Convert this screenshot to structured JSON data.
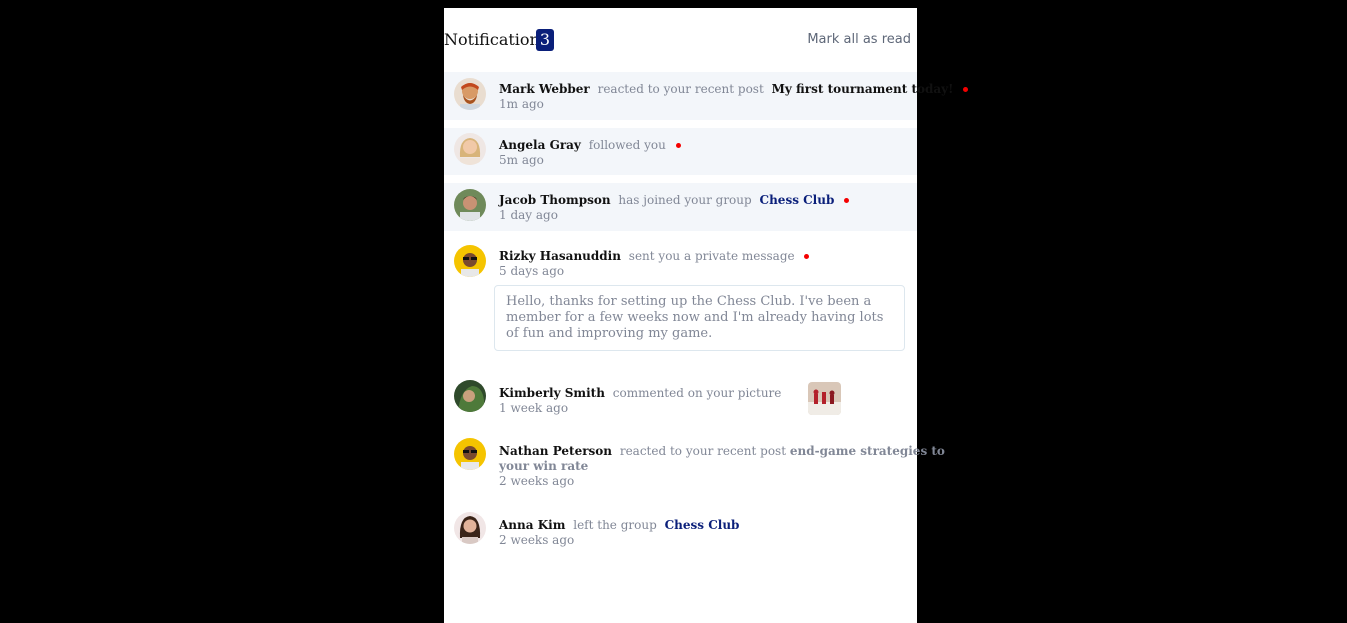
{
  "header": {
    "title": "Notifications",
    "badge_count": "3",
    "mark_all_label": "Mark all as read"
  },
  "notifications": [
    {
      "name": "Mark Webber",
      "action": "reacted to your recent post",
      "target": "My first tournament today!",
      "time": "1m ago",
      "unread": true
    },
    {
      "name": "Angela Gray",
      "action": "followed you",
      "time": "5m ago",
      "unread": true
    },
    {
      "name": "Jacob Thompson",
      "action": "has joined your group",
      "target": "Chess Club",
      "time": "1 day ago",
      "unread": true
    },
    {
      "name": "Rizky Hasanuddin",
      "action": "sent you a private message",
      "time": "5 days ago",
      "unread": true,
      "message": "Hello, thanks for setting up the Chess Club. I've been a member for a few weeks now and I'm already having lots of fun and improving my game."
    },
    {
      "name": "Kimberly Smith",
      "action": "commented on your picture",
      "time": "1 week ago",
      "unread": false
    },
    {
      "name": "Nathan Peterson",
      "action": "reacted to your recent post",
      "target_line1": "end-game strategies to",
      "target_line2": "your win rate",
      "time": "2 weeks ago",
      "unread": false
    },
    {
      "name": "Anna Kim",
      "action": "left the group",
      "target": "Chess Club",
      "time": "2 weeks ago",
      "unread": false
    }
  ],
  "colors": {
    "accent": "#0a1f7a",
    "unread_bg": "#f3f6fa",
    "unread_dot": "#f40000",
    "muted_text": "#818796"
  }
}
